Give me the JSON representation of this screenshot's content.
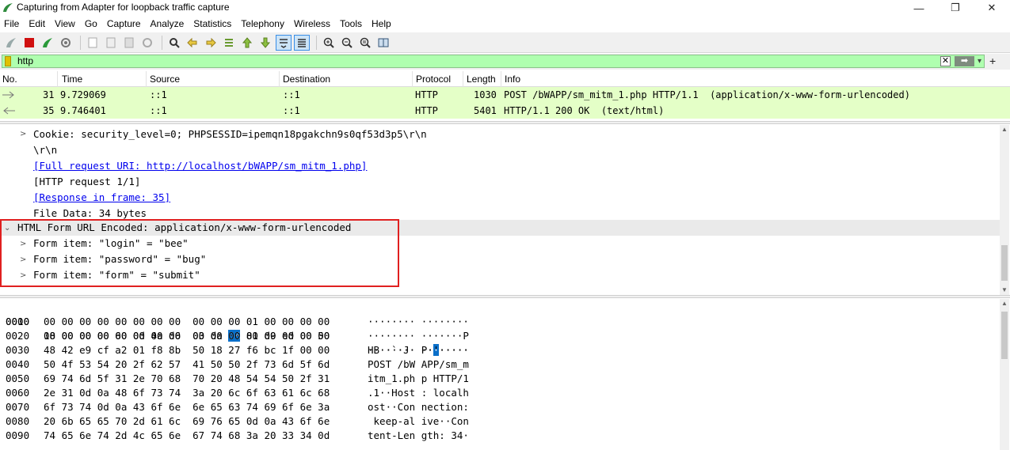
{
  "window": {
    "title": "Capturing from Adapter for loopback traffic capture",
    "minimize": "—",
    "maximize": "❐",
    "close": "✕"
  },
  "menu": [
    "File",
    "Edit",
    "View",
    "Go",
    "Capture",
    "Analyze",
    "Statistics",
    "Telephony",
    "Wireless",
    "Tools",
    "Help"
  ],
  "filter": {
    "value": "http",
    "clear": "✕",
    "apply": "➡",
    "dropdown": "▾",
    "add": "+"
  },
  "packet_list": {
    "columns": [
      "No.",
      "Time",
      "Source",
      "Destination",
      "Protocol",
      "Length",
      "Info"
    ],
    "rows": [
      {
        "no": "31",
        "time": "9.729069",
        "source": "::1",
        "destination": "::1",
        "protocol": "HTTP",
        "length": "1030",
        "info": "POST /bWAPP/sm_mitm_1.php HTTP/1.1  (application/x-www-form-urlencoded)"
      },
      {
        "no": "35",
        "time": "9.746401",
        "source": "::1",
        "destination": "::1",
        "protocol": "HTTP",
        "length": "5401",
        "info": "HTTP/1.1 200 OK  (text/html)"
      }
    ]
  },
  "details": [
    "Cookie: security_level=0; PHPSESSID=ipemqn18pgakchn9s0qf53d3p5\\r\\n",
    "\\r\\n",
    "[Full request URI: http://localhost/bWAPP/sm_mitm_1.php]",
    "[HTTP request 1/1]",
    "[Response in frame: 35]",
    "File Data: 34 bytes",
    "HTML Form URL Encoded: application/x-www-form-urlencoded",
    "Form item: \"login\" = \"bee\"",
    "Form item: \"password\" = \"bug\"",
    "Form item: \"form\" = \"submit\""
  ],
  "bytes": [
    {
      "offset": "0000",
      "hex_a": "18 00 00 00 60 0d 4a d6  03 da ",
      "hex_hl": "06",
      "hex_b": " 80 00 00 00 00",
      "ascii_a": "····`·J· ··",
      "ascii_hl": "·",
      "ascii_b": "·····"
    },
    {
      "offset": "0010",
      "hex": "00 00 00 00 00 00 00 00  00 00 00 01 00 00 00 00",
      "ascii": "········ ········"
    },
    {
      "offset": "0020",
      "hex": "00 00 00 00 00 00 00 00  00 00 00 01 d9 ed 00 50",
      "ascii": "········ ·······P"
    },
    {
      "offset": "0030",
      "hex": "48 42 e9 cf a2 01 f8 8b  50 18 27 f6 bc 1f 00 00",
      "ascii": "HB······ P·'·····"
    },
    {
      "offset": "0040",
      "hex": "50 4f 53 54 20 2f 62 57  41 50 50 2f 73 6d 5f 6d",
      "ascii": "POST /bW APP/sm_m"
    },
    {
      "offset": "0050",
      "hex": "69 74 6d 5f 31 2e 70 68  70 20 48 54 54 50 2f 31",
      "ascii": "itm_1.ph p HTTP/1"
    },
    {
      "offset": "0060",
      "hex": "2e 31 0d 0a 48 6f 73 74  3a 20 6c 6f 63 61 6c 68",
      "ascii": ".1··Host : localh"
    },
    {
      "offset": "0070",
      "hex": "6f 73 74 0d 0a 43 6f 6e  6e 65 63 74 69 6f 6e 3a",
      "ascii": "ost··Con nection:"
    },
    {
      "offset": "0080",
      "hex": "20 6b 65 65 70 2d 61 6c  69 76 65 0d 0a 43 6f 6e",
      "ascii": " keep-al ive··Con"
    },
    {
      "offset": "0090",
      "hex": "74 65 6e 74 2d 4c 65 6e  67 74 68 3a 20 33 34 0d",
      "ascii": "tent-Len gth: 34·"
    }
  ]
}
